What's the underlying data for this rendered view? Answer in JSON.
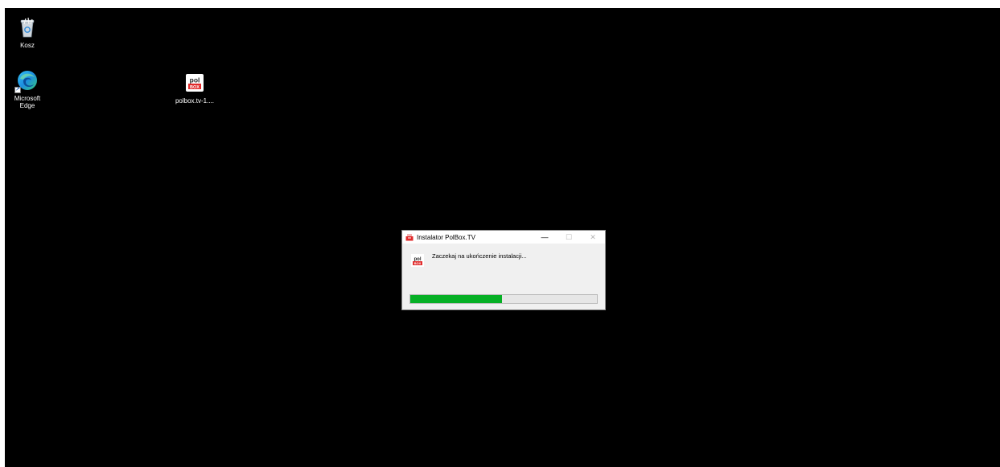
{
  "desktop": {
    "icons": [
      {
        "label": "Kosz",
        "icon": "recycle-bin-icon"
      },
      {
        "label": "Microsoft\nEdge",
        "icon": "edge-icon"
      },
      {
        "label": "polbox.tv-1....",
        "icon": "polbox-icon"
      }
    ]
  },
  "installer": {
    "title": "Instalator PolBox.TV",
    "minimize_glyph": "—",
    "maximize_glyph": "☐",
    "close_glyph": "✕",
    "message": "Zaczekaj na ukończenie instalacji...",
    "progress": 0.49,
    "progress_color": "#06b025"
  },
  "colors": {
    "desktop_background": "#000000",
    "window_background": "#f0f0f0",
    "brand_red": "#e02a2a"
  }
}
